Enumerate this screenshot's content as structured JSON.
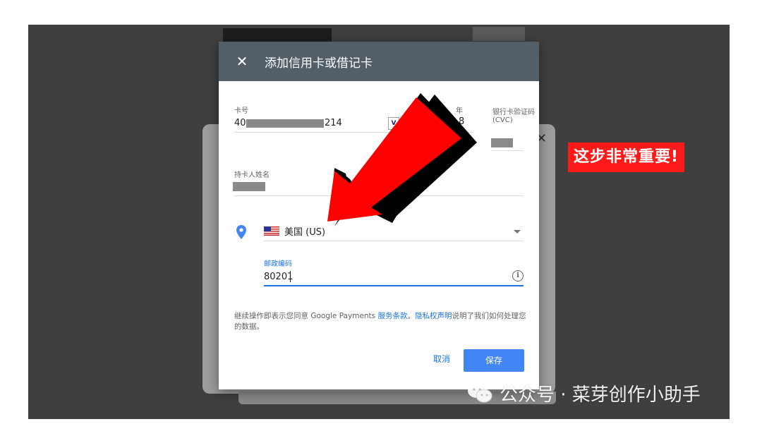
{
  "dialog": {
    "title": "添加信用卡或借记卡",
    "close_icon": "close-icon",
    "card_number": {
      "label": "卡号",
      "prefix": "40",
      "suffix": "214",
      "brand_icon": "visa-icon",
      "brand_text": "V"
    },
    "expiry": {
      "year_label": "年",
      "visible_digit": "8"
    },
    "cvc": {
      "label": "银行卡验证码(CVC)"
    },
    "cardholder": {
      "label": "持卡人姓名"
    },
    "address": {
      "location_icon": "location-pin-icon",
      "flag_icon": "us-flag-icon",
      "country": "美国 (US)",
      "dropdown_icon": "dropdown-arrow-icon"
    },
    "zip": {
      "label": "邮政编码",
      "value": "80201",
      "info_icon": "info-icon",
      "info_glyph": "i"
    },
    "terms": {
      "text_before": "继续操作即表示您同意 Google Payments ",
      "link_tos": "服务条款",
      "sep": "。",
      "link_privacy": "隐私权声明",
      "text_after": "说明了我们如何处理您的数据。"
    },
    "cancel_label": "取消",
    "save_label": "保存"
  },
  "annotation": {
    "text": "这步非常重要!"
  },
  "watermark": {
    "text": "公众号 · 菜芽创作小助手",
    "icon": "wechat-icon"
  },
  "colors": {
    "header": "#525f69",
    "accent": "#1a73e8",
    "save_button": "#4285f4",
    "annotation_bg": "#ff1a1a",
    "arrow": "#ff0000"
  }
}
